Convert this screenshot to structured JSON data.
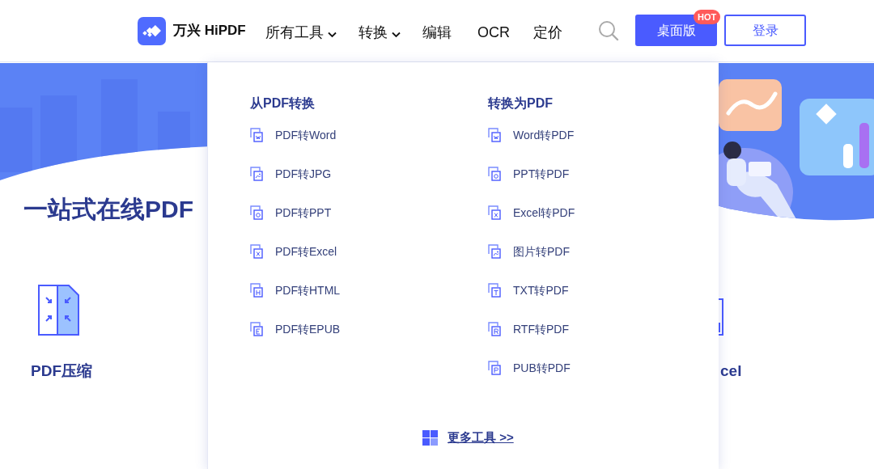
{
  "header": {
    "logo_text": "万兴 HiPDF",
    "nav": [
      {
        "label": "所有工具",
        "has_menu": true
      },
      {
        "label": "转换",
        "has_menu": true
      },
      {
        "label": "编辑",
        "has_menu": false
      },
      {
        "label": "OCR",
        "has_menu": false
      },
      {
        "label": "定价",
        "has_menu": false
      }
    ],
    "desktop_button": "桌面版",
    "badge": "HOT",
    "login_button": "登录"
  },
  "hero": {
    "heading": "一站式在线PDF"
  },
  "tools": [
    {
      "label": "PDF压缩"
    },
    {
      "label": "cel"
    }
  ],
  "dropdown": {
    "columns": [
      {
        "title": "从PDF转换",
        "items": [
          {
            "label": "PDF转Word",
            "kind": "word"
          },
          {
            "label": "PDF转JPG",
            "kind": "image"
          },
          {
            "label": "PDF转PPT",
            "kind": "ppt"
          },
          {
            "label": "PDF转Excel",
            "kind": "excel"
          },
          {
            "label": "PDF转HTML",
            "kind": "html"
          },
          {
            "label": "PDF转EPUB",
            "kind": "epub"
          }
        ]
      },
      {
        "title": "转换为PDF",
        "items": [
          {
            "label": "Word转PDF",
            "kind": "word"
          },
          {
            "label": "PPT转PDF",
            "kind": "ppt"
          },
          {
            "label": "Excel转PDF",
            "kind": "excel"
          },
          {
            "label": "图片转PDF",
            "kind": "image"
          },
          {
            "label": "TXT转PDF",
            "kind": "txt"
          },
          {
            "label": "RTF转PDF",
            "kind": "rtf"
          },
          {
            "label": "PUB转PDF",
            "kind": "pub"
          }
        ]
      }
    ],
    "more_link": "更多工具 >>"
  }
}
